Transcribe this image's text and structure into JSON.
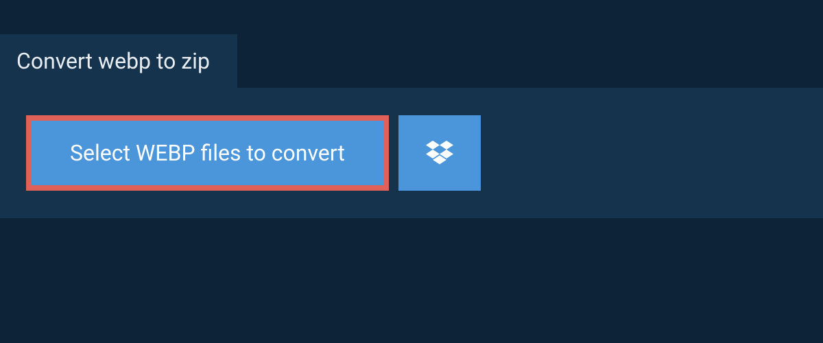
{
  "tab": {
    "title": "Convert webp to zip"
  },
  "actions": {
    "select_button_label": "Select WEBP files to convert"
  },
  "colors": {
    "background": "#0d2438",
    "panel": "#16334d",
    "button": "#4b95db",
    "highlight_border": "#e06158",
    "text_light": "#e8edf2",
    "white": "#ffffff"
  }
}
